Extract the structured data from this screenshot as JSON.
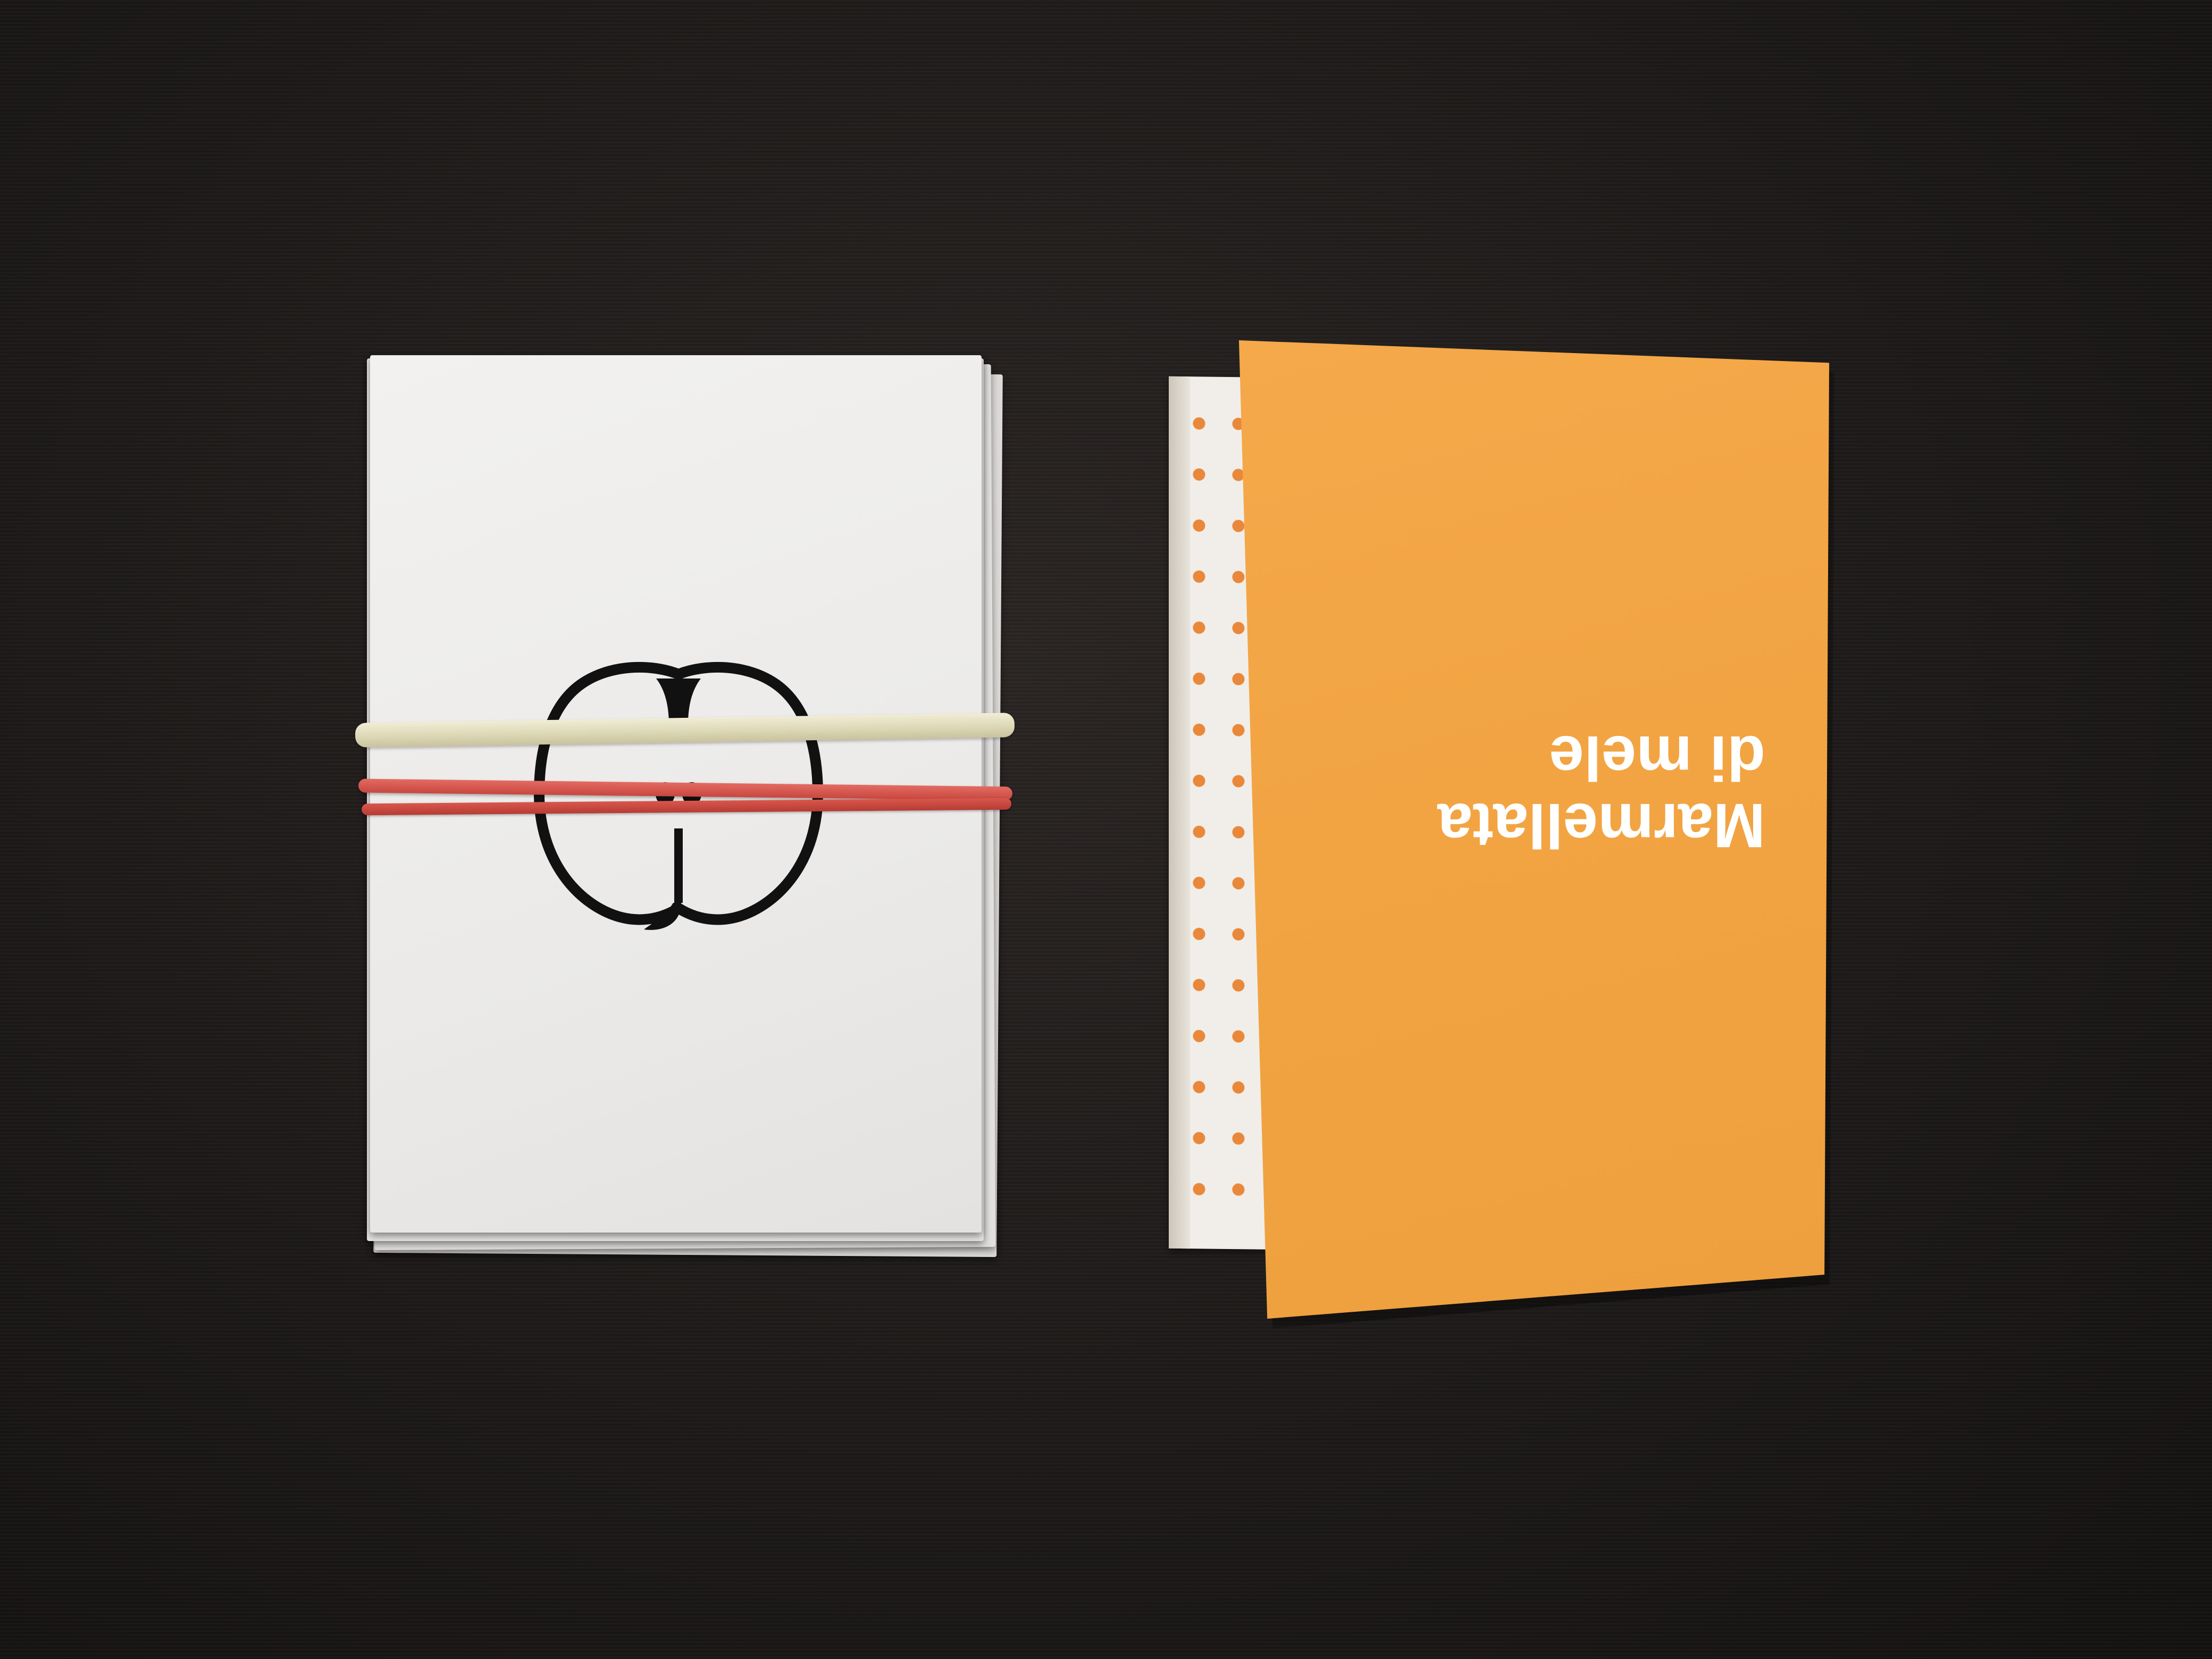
{
  "scene": {
    "background_color": "#1d1a19"
  },
  "left_stack": {
    "paper_color": "#efeeec",
    "illustration": "apple-cross-section-icon",
    "bands": [
      {
        "color": "#ddd8b6"
      },
      {
        "color": "#d9574c"
      },
      {
        "color": "#c8473f"
      }
    ]
  },
  "booklet": {
    "cover_color": "#f2a443",
    "dot_color": "#e9883a",
    "title_line_1": "Marmellata",
    "title_line_2": "di mele"
  }
}
